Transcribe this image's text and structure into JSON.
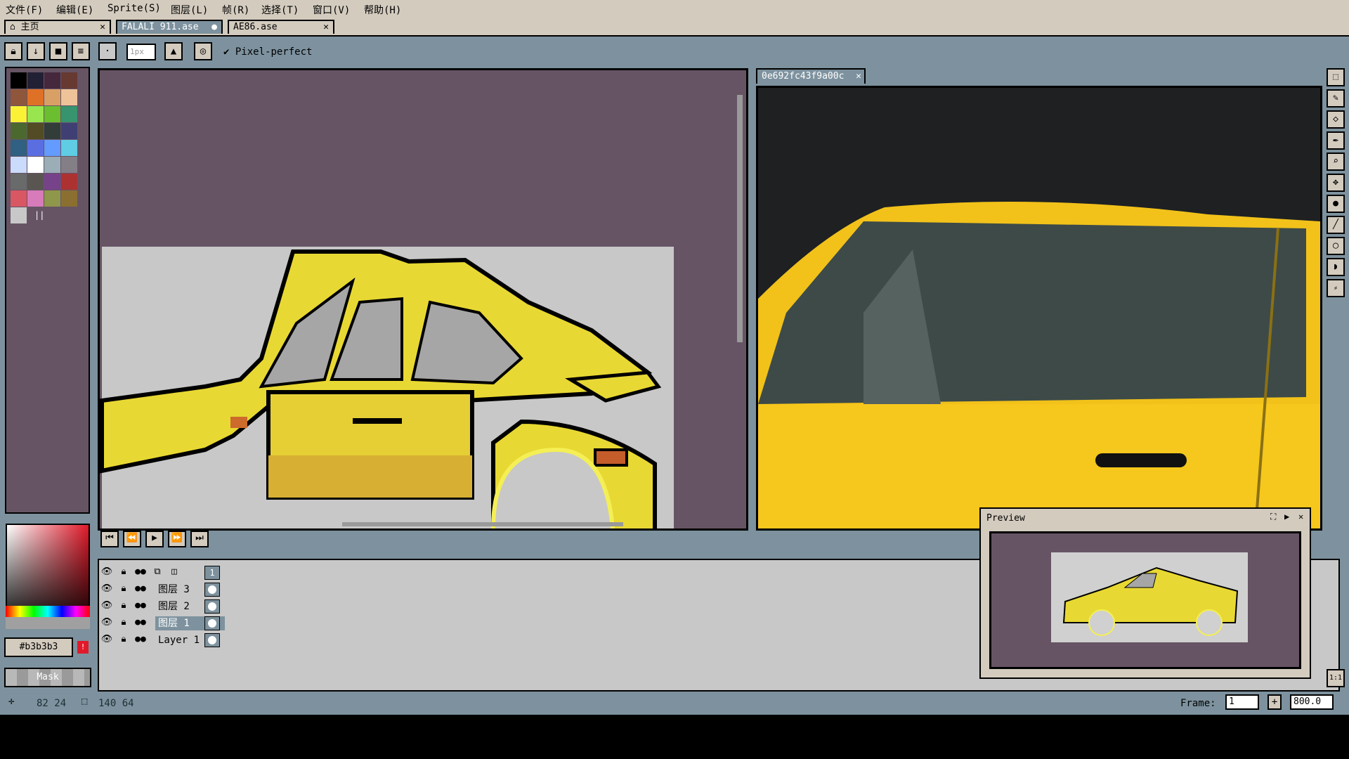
{
  "menu": [
    "文件(F)",
    "编辑(E)",
    "Sprite(S)",
    "图层(L)",
    "帧(R)",
    "选择(T)",
    "窗口(V)",
    "帮助(H)"
  ],
  "tabs": {
    "home": "主页",
    "file1": "FALALI 911.ase",
    "file2": "AE86.ase"
  },
  "toolbar": {
    "brush_size": "1px",
    "pixel_perfect": "Pixel-perfect"
  },
  "reference_tab": "0e692fc43f9a00c",
  "color": {
    "hex": "#b3b3b3",
    "mask_label": "Mask"
  },
  "palette": [
    "#000000",
    "#222034",
    "#45283c",
    "#663931",
    "#8f563b",
    "#df7126",
    "#d9a066",
    "#eec39a",
    "#fbf236",
    "#99e550",
    "#6abe30",
    "#37946e",
    "#4b692f",
    "#524b24",
    "#323c39",
    "#3f3f74",
    "#306082",
    "#5b6ee1",
    "#639bff",
    "#5fcde4",
    "#cbdbfc",
    "#ffffff",
    "#9badb7",
    "#847e87",
    "#696a6a",
    "#595652",
    "#76428a",
    "#ac3232",
    "#d95763",
    "#d77bba",
    "#8f974a",
    "#8a6f30",
    "#c8c8c8"
  ],
  "timeline": {
    "frame_number": "1",
    "layers": [
      {
        "name": "图层 3"
      },
      {
        "name": "图层 2"
      },
      {
        "name": "图层 1"
      },
      {
        "name": "Layer 1"
      }
    ]
  },
  "preview": {
    "title": "Preview"
  },
  "status": {
    "cursor": "82 24",
    "size": "140 64",
    "frame_label": "Frame:",
    "frame_value": "1",
    "zoom_value": "800.0"
  },
  "right_tools": [
    "selection-icon",
    "pencil-icon",
    "eraser-icon",
    "eyedropper-icon",
    "zoom-icon",
    "move-icon",
    "fill-icon",
    "line-icon",
    "ellipse-icon",
    "contour-icon",
    "blur-icon"
  ]
}
